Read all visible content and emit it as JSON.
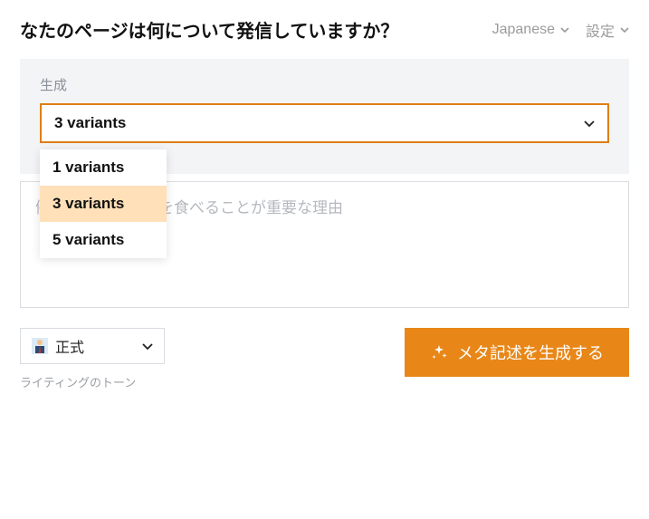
{
  "header": {
    "title": "なたのページは何について発信していますか？",
    "language_label": "Japanese",
    "settings_label": "設定"
  },
  "variants": {
    "label": "生成",
    "selected": "3 variants",
    "options": [
      "1 variants",
      "3 variants",
      "5 variants"
    ]
  },
  "topic": {
    "placeholder": "例：ブルーベリーを食べることが重要な理由"
  },
  "tone": {
    "value": "正式",
    "caption": "ライティングのトーン"
  },
  "cta": {
    "generate": "メタ記述を生成する"
  }
}
